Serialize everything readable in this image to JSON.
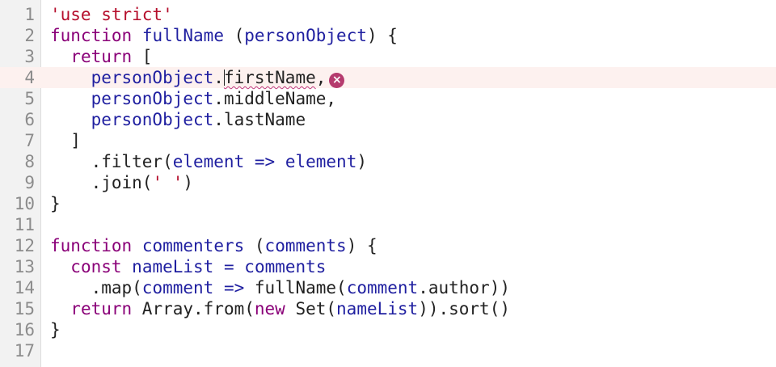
{
  "editor": {
    "colors": {
      "keyword": "#8a0078",
      "string": "#b50e2c",
      "identifier": "#1f1fa0",
      "plain": "#222222",
      "line_number": "#8c8c8c",
      "error": "#b53b6e",
      "current_line_bg": "#fdf1ef"
    },
    "current_line": 4,
    "error_icon": "error-circle-x-icon",
    "lines": [
      {
        "num": "1",
        "tokens": [
          [
            "str",
            "'use strict'"
          ]
        ]
      },
      {
        "num": "2",
        "tokens": [
          [
            "kw",
            "function"
          ],
          [
            "pl",
            " "
          ],
          [
            "fn",
            "fullName"
          ],
          [
            "pl",
            " ("
          ],
          [
            "id",
            "personObject"
          ],
          [
            "pl",
            ") {"
          ]
        ]
      },
      {
        "num": "3",
        "tokens": [
          [
            "pl",
            "  "
          ],
          [
            "kw",
            "return"
          ],
          [
            "pl",
            " ["
          ]
        ]
      },
      {
        "num": "4",
        "tokens": [
          [
            "pl",
            "    "
          ],
          [
            "id",
            "personObject"
          ],
          [
            "pl",
            "."
          ],
          [
            "caret",
            ""
          ],
          [
            "err",
            "firstName"
          ],
          [
            "pl",
            ","
          ],
          [
            "erricon",
            "×"
          ]
        ]
      },
      {
        "num": "5",
        "tokens": [
          [
            "pl",
            "    "
          ],
          [
            "id",
            "personObject"
          ],
          [
            "pl",
            ".middleName,"
          ]
        ]
      },
      {
        "num": "6",
        "tokens": [
          [
            "pl",
            "    "
          ],
          [
            "id",
            "personObject"
          ],
          [
            "pl",
            ".lastName"
          ]
        ]
      },
      {
        "num": "7",
        "tokens": [
          [
            "pl",
            "  ]"
          ]
        ]
      },
      {
        "num": "8",
        "tokens": [
          [
            "pl",
            "    .filter("
          ],
          [
            "id",
            "element"
          ],
          [
            "pl",
            " "
          ],
          [
            "op",
            "=>"
          ],
          [
            "pl",
            " "
          ],
          [
            "id",
            "element"
          ],
          [
            "pl",
            ")"
          ]
        ]
      },
      {
        "num": "9",
        "tokens": [
          [
            "pl",
            "    .join("
          ],
          [
            "str",
            "' '"
          ],
          [
            "pl",
            ")"
          ]
        ]
      },
      {
        "num": "10",
        "tokens": [
          [
            "pl",
            "}"
          ]
        ]
      },
      {
        "num": "11",
        "tokens": []
      },
      {
        "num": "12",
        "tokens": [
          [
            "kw",
            "function"
          ],
          [
            "pl",
            " "
          ],
          [
            "fn",
            "commenters"
          ],
          [
            "pl",
            " ("
          ],
          [
            "id",
            "comments"
          ],
          [
            "pl",
            ") {"
          ]
        ]
      },
      {
        "num": "13",
        "tokens": [
          [
            "pl",
            "  "
          ],
          [
            "kw",
            "const"
          ],
          [
            "pl",
            " "
          ],
          [
            "id",
            "nameList"
          ],
          [
            "pl",
            " "
          ],
          [
            "op",
            "="
          ],
          [
            "pl",
            " "
          ],
          [
            "id",
            "comments"
          ]
        ]
      },
      {
        "num": "14",
        "tokens": [
          [
            "pl",
            "    .map("
          ],
          [
            "id",
            "comment"
          ],
          [
            "pl",
            " "
          ],
          [
            "op",
            "=>"
          ],
          [
            "pl",
            " fullName("
          ],
          [
            "id",
            "comment"
          ],
          [
            "pl",
            ".author))"
          ]
        ]
      },
      {
        "num": "15",
        "tokens": [
          [
            "pl",
            "  "
          ],
          [
            "kw",
            "return"
          ],
          [
            "pl",
            " Array.from("
          ],
          [
            "kw",
            "new"
          ],
          [
            "pl",
            " Set("
          ],
          [
            "id",
            "nameList"
          ],
          [
            "pl",
            ")).sort()"
          ]
        ]
      },
      {
        "num": "16",
        "tokens": [
          [
            "pl",
            "}"
          ]
        ]
      },
      {
        "num": "17",
        "tokens": []
      }
    ]
  }
}
